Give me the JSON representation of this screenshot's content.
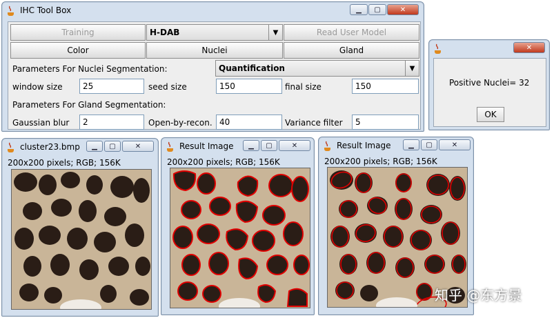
{
  "toolbox": {
    "title": "IHC Tool Box",
    "training_label": "Training",
    "stain_value": "H-DAB",
    "read_model_label": "Read User Model",
    "color_label": "Color",
    "nuclei_label": "Nuclei",
    "gland_label": "Gland",
    "nuclei_params_label": "Parameters For Nuclei Segmentation:",
    "mode_value": "Quantification",
    "window_size_label": "window size",
    "window_size_value": "25",
    "seed_size_label": "seed size",
    "seed_size_value": "150",
    "final_size_label": "final size",
    "final_size_value": "150",
    "gland_params_label": "Parameters For Gland Segmentation:",
    "gaussian_label": "Gaussian blur",
    "gaussian_value": "2",
    "open_label": "Open-by-recon.",
    "open_value": "40",
    "variance_label": "Variance filter",
    "variance_value": "5"
  },
  "dialog": {
    "message": "Positive Nuclei= 32",
    "ok_label": "OK"
  },
  "image_windows": [
    {
      "title": "cluster23.bmp",
      "info": "200x200 pixels; RGB; 156K"
    },
    {
      "title": "Result Image",
      "info": "200x200 pixels; RGB; 156K"
    },
    {
      "title": "Result Image",
      "info": "200x200 pixels; RGB; 156K"
    }
  ],
  "watermark": "知乎 @东方景",
  "colors": {
    "window_frame": "#d4e0ee",
    "client_bg": "#eeeeee",
    "contour_red": "#e00000",
    "close_red": "#c1391d"
  }
}
